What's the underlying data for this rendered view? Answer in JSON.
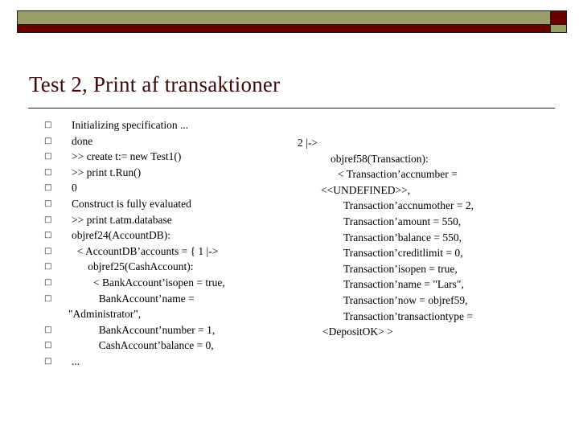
{
  "slide": {
    "title": "Test 2, Print af transaktioner",
    "title_color": "#3d0a0a",
    "band_olive_color": "#9a9e6a",
    "band_red_color": "#6b0000",
    "bullet_glyph": "□"
  },
  "left_column": {
    "items": [
      {
        "bullet": true,
        "text": "Initializing specification ...",
        "indent": 0
      },
      {
        "bullet": true,
        "text": "done",
        "indent": 0
      },
      {
        "bullet": true,
        "text": ">> create t:= new Test1()",
        "indent": 0
      },
      {
        "bullet": true,
        "text": ">> print t.Run()",
        "indent": 0
      },
      {
        "bullet": true,
        "text": "0",
        "indent": 0
      },
      {
        "bullet": true,
        "text": "Construct is fully evaluated",
        "indent": 0
      },
      {
        "bullet": true,
        "text": ">> print t.atm.database",
        "indent": 0
      },
      {
        "bullet": true,
        "text": "objref24(AccountDB):",
        "indent": 0
      },
      {
        "bullet": true,
        "text": "  < AccountDB’accounts = { 1 |->",
        "indent": 0
      },
      {
        "bullet": true,
        "text": "      objref25(CashAccount):",
        "indent": 0
      },
      {
        "bullet": true,
        "text": "        < BankAccount’isopen = true,",
        "indent": 0
      },
      {
        "bullet": true,
        "text": "          BankAccount’name =",
        "indent": 0
      },
      {
        "bullet": false,
        "text": "\"Administrator\",",
        "indent": 0
      },
      {
        "bullet": true,
        "text": "          BankAccount’number = 1,",
        "indent": 0
      },
      {
        "bullet": true,
        "text": "          CashAccount’balance = 0,",
        "indent": 0
      },
      {
        "bullet": true,
        "text": "...",
        "indent": 0
      }
    ]
  },
  "right_column": {
    "lines": [
      {
        "text": "2 |->",
        "pad": 5
      },
      {
        "text": "objref58(Transaction):",
        "pad": 46
      },
      {
        "text": "< Transaction’accnumber =",
        "pad": 55
      },
      {
        "text": "<<UNDEFINED>>,",
        "pad": 34
      },
      {
        "text": "Transaction’accnumother = 2,",
        "pad": 62
      },
      {
        "text": "Transaction’amount = 550,",
        "pad": 62
      },
      {
        "text": "Transaction’balance = 550,",
        "pad": 62
      },
      {
        "text": "Transaction’creditlimit = 0,",
        "pad": 62
      },
      {
        "text": "Transaction’isopen = true,",
        "pad": 62
      },
      {
        "text": "Transaction’name = \"Lars\",",
        "pad": 62
      },
      {
        "text": "Transaction’now = objref59,",
        "pad": 62
      },
      {
        "text": "Transaction’transactiontype =",
        "pad": 62
      },
      {
        "text": "<DepositOK> >",
        "pad": 36
      }
    ]
  }
}
